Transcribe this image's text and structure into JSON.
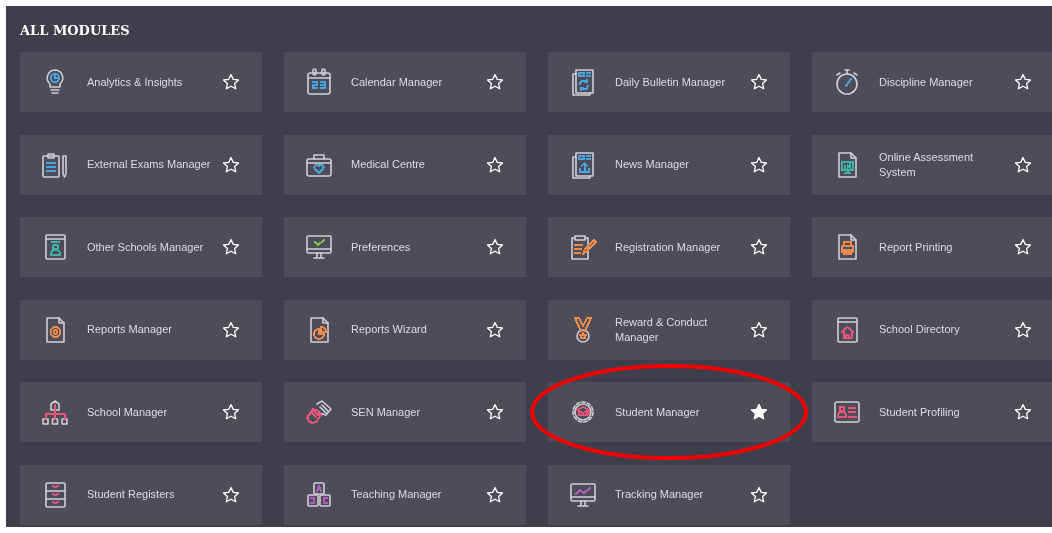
{
  "title": "ALL MODULES",
  "modules": [
    {
      "label": "Analytics & Insights",
      "color": "#4aa3df",
      "favorite": false,
      "circled": false
    },
    {
      "label": "Calendar Manager",
      "color": "#4aa3df",
      "favorite": false,
      "circled": false
    },
    {
      "label": "Daily Bulletin Manager",
      "color": "#4aa3df",
      "favorite": false,
      "circled": false
    },
    {
      "label": "Discipline Manager",
      "color": "#4aa3df",
      "favorite": false,
      "circled": false
    },
    {
      "label": "External Exams Manager",
      "color": "#4aa3df",
      "favorite": false,
      "circled": false
    },
    {
      "label": "Medical Centre",
      "color": "#4aa3df",
      "favorite": false,
      "circled": false
    },
    {
      "label": "News Manager",
      "color": "#4aa3df",
      "favorite": false,
      "circled": false
    },
    {
      "label": "Online Assessment System",
      "color": "#3fb3a3",
      "favorite": false,
      "circled": false
    },
    {
      "label": "Other Schools Manager",
      "color": "#3fb3a3",
      "favorite": false,
      "circled": false
    },
    {
      "label": "Preferences",
      "color": "#7cc04b",
      "favorite": false,
      "circled": false
    },
    {
      "label": "Registration Manager",
      "color": "#f08a4b",
      "favorite": false,
      "circled": false
    },
    {
      "label": "Report Printing",
      "color": "#f08a4b",
      "favorite": false,
      "circled": false
    },
    {
      "label": "Reports Manager",
      "color": "#f08a4b",
      "favorite": false,
      "circled": false
    },
    {
      "label": "Reports Wizard",
      "color": "#f08a4b",
      "favorite": false,
      "circled": false
    },
    {
      "label": "Reward & Conduct Manager",
      "color": "#f08a4b",
      "favorite": false,
      "circled": false
    },
    {
      "label": "School Directory",
      "color": "#e8557a",
      "favorite": false,
      "circled": false
    },
    {
      "label": "School Manager",
      "color": "#e8557a",
      "favorite": false,
      "circled": false
    },
    {
      "label": "SEN Manager",
      "color": "#e8557a",
      "favorite": false,
      "circled": false
    },
    {
      "label": "Student Manager",
      "color": "#e8557a",
      "favorite": true,
      "circled": true
    },
    {
      "label": "Student Profiling",
      "color": "#e8557a",
      "favorite": false,
      "circled": false
    },
    {
      "label": "Student Registers",
      "color": "#e8557a",
      "favorite": false,
      "circled": false
    },
    {
      "label": "Teaching Manager",
      "color": "#b45cc0",
      "favorite": false,
      "circled": false
    },
    {
      "label": "Tracking Manager",
      "color": "#b45cc0",
      "favorite": false,
      "circled": false
    }
  ]
}
